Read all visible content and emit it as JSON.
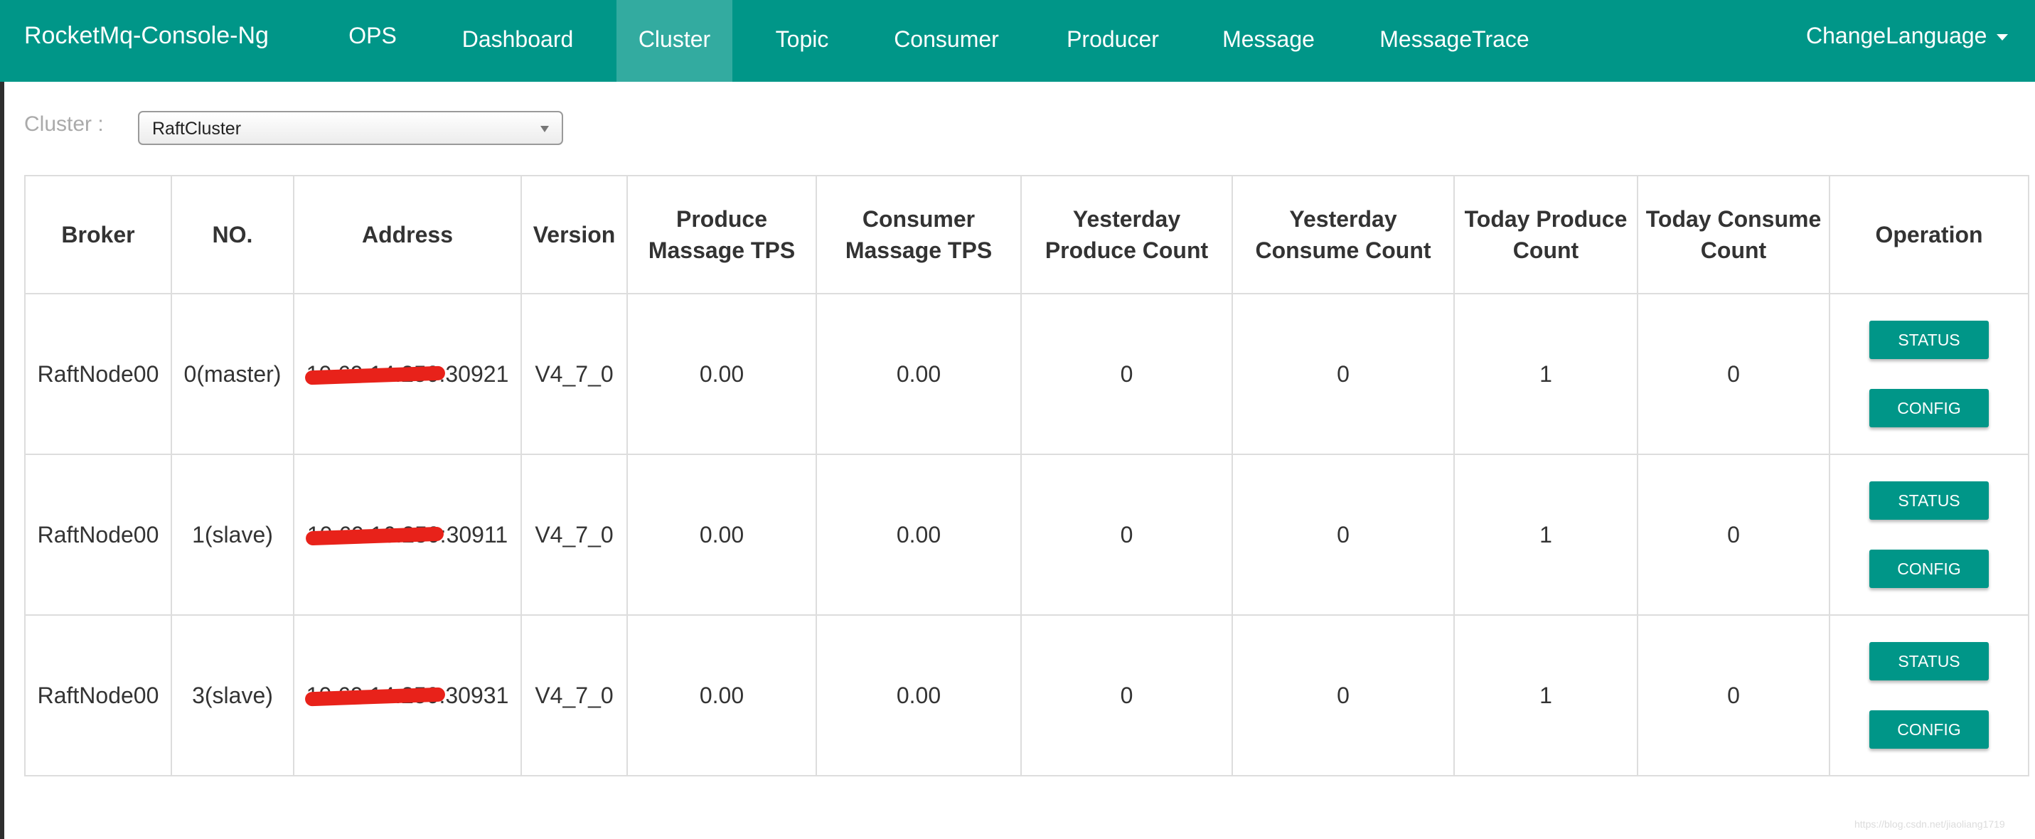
{
  "navbar": {
    "brand": "RocketMq-Console-Ng",
    "items": [
      {
        "label": "OPS"
      },
      {
        "label": "Dashboard"
      },
      {
        "label": "Cluster"
      },
      {
        "label": "Topic"
      },
      {
        "label": "Consumer"
      },
      {
        "label": "Producer"
      },
      {
        "label": "Message"
      },
      {
        "label": "MessageTrace"
      }
    ],
    "active": "Cluster",
    "language_label": "ChangeLanguage"
  },
  "cluster_selector": {
    "label": "Cluster :",
    "selected": "RaftCluster"
  },
  "table": {
    "columns": [
      "Broker",
      "NO.",
      "Address",
      "Version",
      "Produce Massage TPS",
      "Consumer Massage TPS",
      "Yesterday Produce Count",
      "Yesterday Consume Count",
      "Today Produce Count",
      "Today Consume Count",
      "Operation"
    ],
    "rows": [
      {
        "broker": "RaftNode00",
        "no": "0(master)",
        "address": "10.69.14.250:30921",
        "version": "V4_7_0",
        "produce_tps": "0.00",
        "consumer_tps": "0.00",
        "yesterday_produce": "0",
        "yesterday_consume": "0",
        "today_produce": "1",
        "today_consume": "0",
        "status_label": "STATUS",
        "config_label": "CONFIG"
      },
      {
        "broker": "RaftNode00",
        "no": "1(slave)",
        "address": "10.69.16.250:30911",
        "version": "V4_7_0",
        "produce_tps": "0.00",
        "consumer_tps": "0.00",
        "yesterday_produce": "0",
        "yesterday_consume": "0",
        "today_produce": "1",
        "today_consume": "0",
        "status_label": "STATUS",
        "config_label": "CONFIG"
      },
      {
        "broker": "RaftNode00",
        "no": "3(slave)",
        "address": "10.69.14.250:30931",
        "version": "V4_7_0",
        "produce_tps": "0.00",
        "consumer_tps": "0.00",
        "yesterday_produce": "0",
        "yesterday_consume": "0",
        "today_produce": "1",
        "today_consume": "0",
        "status_label": "STATUS",
        "config_label": "CONFIG"
      }
    ]
  },
  "watermark": "https://blog.csdn.net/jiaoliang1719",
  "colors": {
    "primary": "#009688",
    "nav_active": "#33aba0",
    "redaction": "#e8221a"
  }
}
